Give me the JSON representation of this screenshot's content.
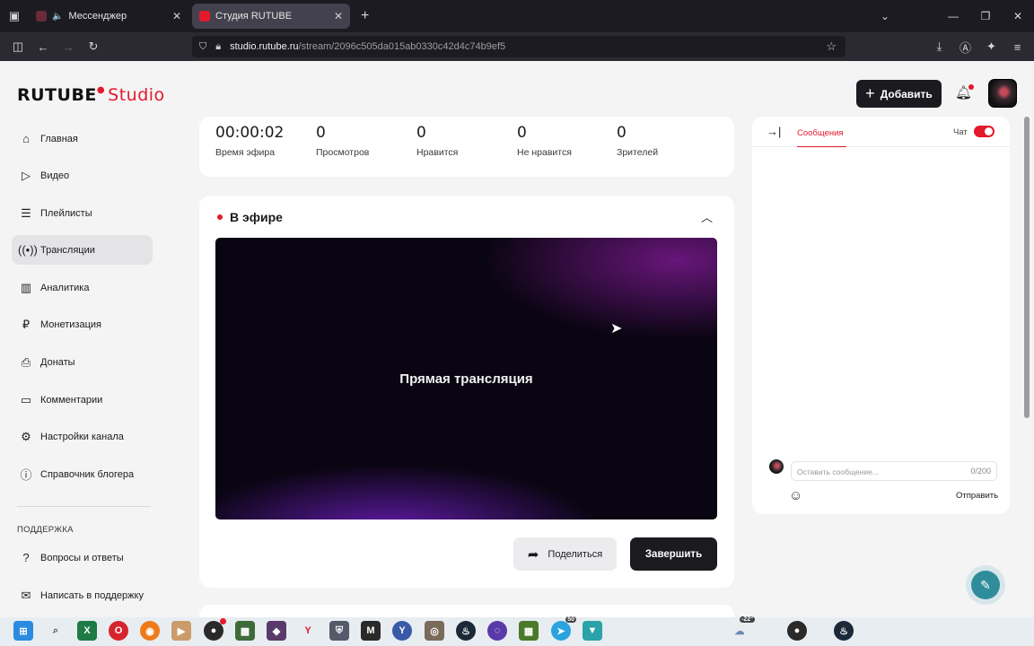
{
  "browser": {
    "tabs": [
      {
        "title": "Мессенджер",
        "active": false
      },
      {
        "title": "Студия RUTUBE",
        "active": true
      }
    ],
    "url_domain": "studio.rutube.ru",
    "url_path": "/stream/2096c505da015ab0330c42d4c74b9ef5"
  },
  "header": {
    "logo_main": "RUTUBE",
    "logo_sub": "Studio",
    "add_label": "Добавить"
  },
  "sidebar": {
    "items": [
      {
        "label": "Главная",
        "icon": "home-icon"
      },
      {
        "label": "Видео",
        "icon": "video-icon"
      },
      {
        "label": "Плейлисты",
        "icon": "playlist-icon"
      },
      {
        "label": "Трансляции",
        "icon": "broadcast-icon",
        "active": true
      },
      {
        "label": "Аналитика",
        "icon": "chart-icon"
      },
      {
        "label": "Монетизация",
        "icon": "ruble-icon"
      },
      {
        "label": "Донаты",
        "icon": "donate-icon"
      },
      {
        "label": "Комментарии",
        "icon": "comment-icon"
      },
      {
        "label": "Настройки канала",
        "icon": "settings-icon"
      },
      {
        "label": "Справочник блогера",
        "icon": "help-icon"
      }
    ],
    "support_header": "ПОДДЕРЖКА",
    "support_items": [
      {
        "label": "Вопросы и ответы",
        "icon": "faq-icon"
      },
      {
        "label": "Написать в поддержку",
        "icon": "mail-icon"
      }
    ]
  },
  "stats": [
    {
      "value": "00:00:02",
      "label": "Время эфира"
    },
    {
      "value": "0",
      "label": "Просмотров"
    },
    {
      "value": "0",
      "label": "Нравится"
    },
    {
      "value": "0",
      "label": "Не нравится"
    },
    {
      "value": "0",
      "label": "Зрителей"
    }
  ],
  "live": {
    "title": "В эфире",
    "player_text": "Прямая трансляция",
    "share_label": "Поделиться",
    "finish_label": "Завершить"
  },
  "chat": {
    "tab_label": "Сообщения",
    "toggle_label": "Чат",
    "toggle_on": true,
    "input_placeholder": "Оставить сообщение...",
    "counter": "0/200",
    "send_label": "Отправить"
  },
  "taskbar": {
    "telegram_badge": "50",
    "weather": "-22°"
  },
  "colors": {
    "accent": "#e4192c",
    "dark_button": "#1b1b1f",
    "support_fab": "#2f8d9b"
  }
}
